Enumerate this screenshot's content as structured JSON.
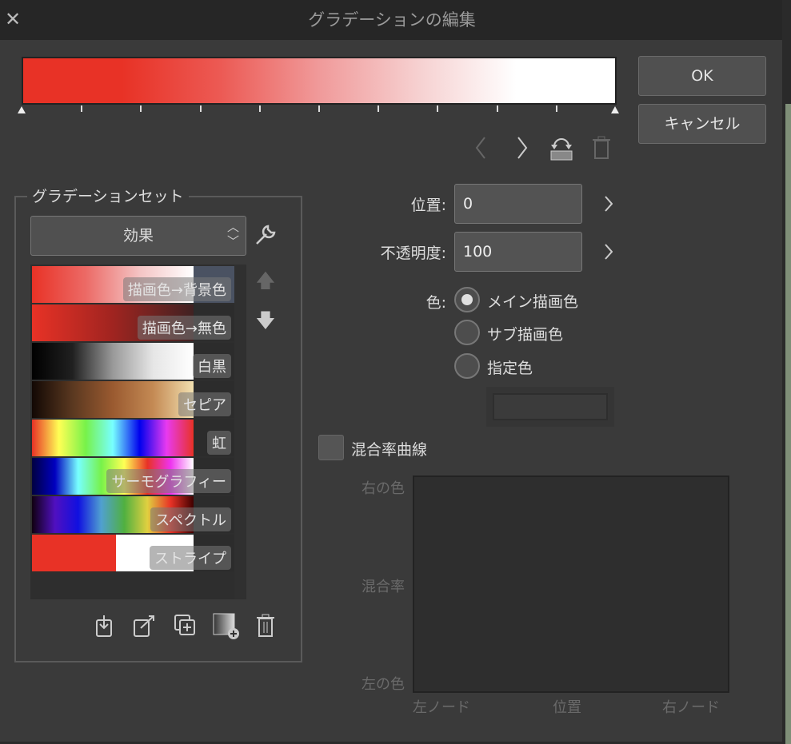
{
  "title": "グラデーションの編集",
  "buttons": {
    "ok": "OK",
    "cancel": "キャンセル"
  },
  "gradient": {
    "colors": [
      "#e83226",
      "#e83226",
      "#ec5a54",
      "#f09a9a",
      "#f6d0d0",
      "#ffffff",
      "#ffffff"
    ]
  },
  "gradient_set": {
    "label": "グラデーションセット",
    "selected": "効果",
    "items": [
      {
        "label": "描画色→背景色",
        "colors": [
          "#e83226",
          "#ec6a66",
          "#f4c4c4",
          "#ffffff"
        ],
        "tail": "#4a5262"
      },
      {
        "label": "描画色→無色",
        "colors": [
          "#e83226",
          "#a02420",
          "#402222"
        ],
        "tail": "#2c2c2c"
      },
      {
        "label": "白黒",
        "colors": [
          "#000000",
          "#202020",
          "#999999",
          "#e6e6e6",
          "#ffffff"
        ],
        "tail": "#2c2c2c"
      },
      {
        "label": "セピア",
        "colors": [
          "#120804",
          "#5a3820",
          "#9a5a30",
          "#c48a54",
          "#f2e0b0"
        ],
        "tail": "#2c2c2c"
      },
      {
        "label": "虹",
        "colors": [
          "#e83226",
          "#ffff55",
          "#77f24a",
          "#77ffff",
          "#0000ee",
          "#e83af0",
          "#e83226"
        ],
        "tail": "#2c2c2c"
      },
      {
        "label": "サーモグラフィー",
        "colors": [
          "#000040",
          "#0000c0",
          "#77ffff",
          "#77f24a",
          "#ffff55",
          "#e83226",
          "#ee33ee",
          "#ffffff"
        ],
        "tail": "#2c2c2c"
      },
      {
        "label": "スペクトル",
        "colors": [
          "#100010",
          "#5010c0",
          "#1010e0",
          "#50a0d0",
          "#50b040",
          "#e0d040",
          "#e83226",
          "#400000"
        ],
        "tail": "#2c2c2c"
      },
      {
        "label": "ストライプ",
        "colors": [
          "#e83226",
          "#e83226",
          "#ffffff",
          "#ffffff"
        ],
        "stops": [
          0,
          52,
          52,
          100
        ],
        "tail": "#2c2c2c"
      }
    ]
  },
  "fields": {
    "position_label": "位置:",
    "position_value": "0",
    "opacity_label": "不透明度:",
    "opacity_value": "100",
    "color_label": "色:"
  },
  "color_options": [
    "メイン描画色",
    "サブ描画色",
    "指定色"
  ],
  "blend": {
    "checkbox_label": "混合率曲線",
    "right_color": "右の色",
    "rate": "混合率",
    "left_color": "左の色",
    "left_node": "左ノード",
    "position": "位置",
    "right_node": "右ノード"
  }
}
